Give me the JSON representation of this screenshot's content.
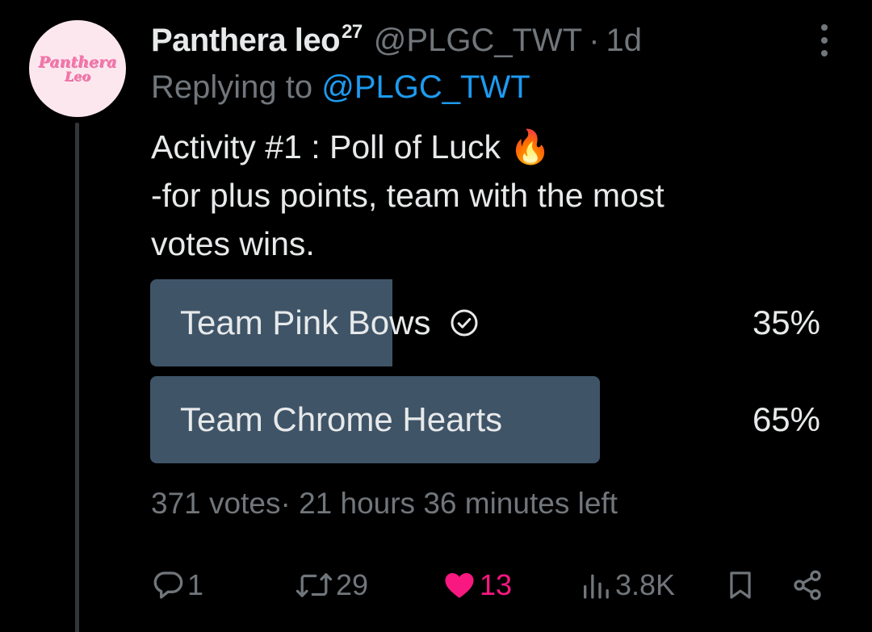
{
  "author": {
    "avatar_text_line1": "Panthera",
    "avatar_text_line2": "Leo",
    "display_name": "Panthera leo",
    "name_superscript": "27",
    "handle": "@PLGC_TWT",
    "separator": "·",
    "time": "1d"
  },
  "reply": {
    "prefix": "Replying to",
    "mention": "@PLGC_TWT"
  },
  "tweet": {
    "line1": "Activity #1 : Poll of Luck 🔥",
    "line2": "-for plus points, team with the most",
    "line3": "votes wins."
  },
  "poll": {
    "options": [
      {
        "label": "Team Pink Bows",
        "percent_text": "35%",
        "percent": 35,
        "selected": true
      },
      {
        "label": "Team Chrome Hearts",
        "percent_text": "65%",
        "percent": 65,
        "selected": false
      }
    ],
    "votes_text": "371 votes",
    "meta_separator": "·",
    "time_left": "21 hours 36 minutes left"
  },
  "actions": {
    "reply_count": "1",
    "retweet_count": "29",
    "like_count": "13",
    "views_count": "3.8K"
  },
  "colors": {
    "background": "#000000",
    "text": "#e7e9ea",
    "muted": "#71767b",
    "accent": "#1d9bf0",
    "like": "#f91880",
    "poll_bar": "#3f5467"
  },
  "icons": [
    "more-icon",
    "check-circle-icon",
    "reply-icon",
    "retweet-icon",
    "heart-icon",
    "views-icon",
    "bookmark-icon",
    "share-icon"
  ]
}
